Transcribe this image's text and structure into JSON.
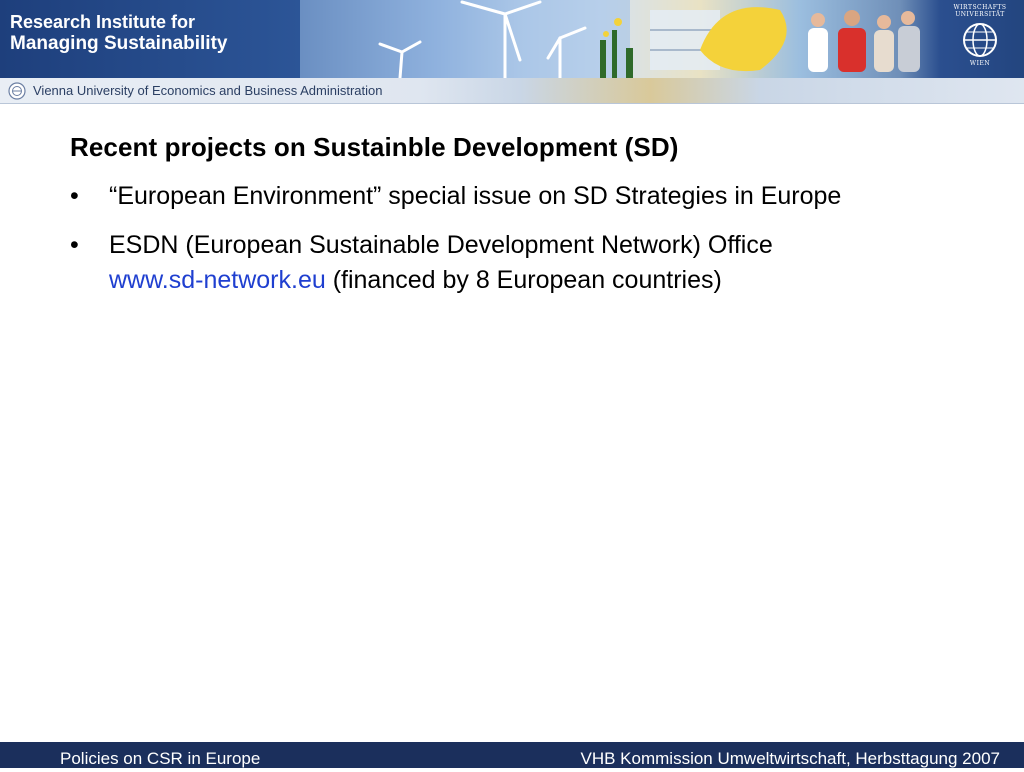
{
  "header": {
    "brand_line1": "Research Institute for",
    "brand_line2": "Managing Sustainability",
    "logo_text_top": "WIRTSCHAFTS UNIVERSITÄT",
    "logo_text_bottom": "WIEN",
    "university": "Vienna University of Economics and Business Administration",
    "icons": [
      "wind-turbine-icon",
      "university-seal-icon",
      "globe-logo-icon"
    ]
  },
  "slide": {
    "title": "Recent projects on Sustainble Development (SD)",
    "bullet_glyph": "•",
    "bullets": [
      {
        "text": "“European Environment” special issue on SD Strategies in Europe"
      },
      {
        "text_before": "ESDN (European Sustainable Development Network) Office",
        "link": "www.sd-network.eu",
        "text_after": " (financed by 8 European countries)"
      }
    ]
  },
  "footer": {
    "left": "Policies on CSR in Europe",
    "right": "VHB Kommission Umweltwirtschaft, Herbsttagung 2007"
  },
  "colors": {
    "brand_blue": "#1e3f7c",
    "footer_bg": "#1b2f5c",
    "link": "#1f3fd0"
  }
}
